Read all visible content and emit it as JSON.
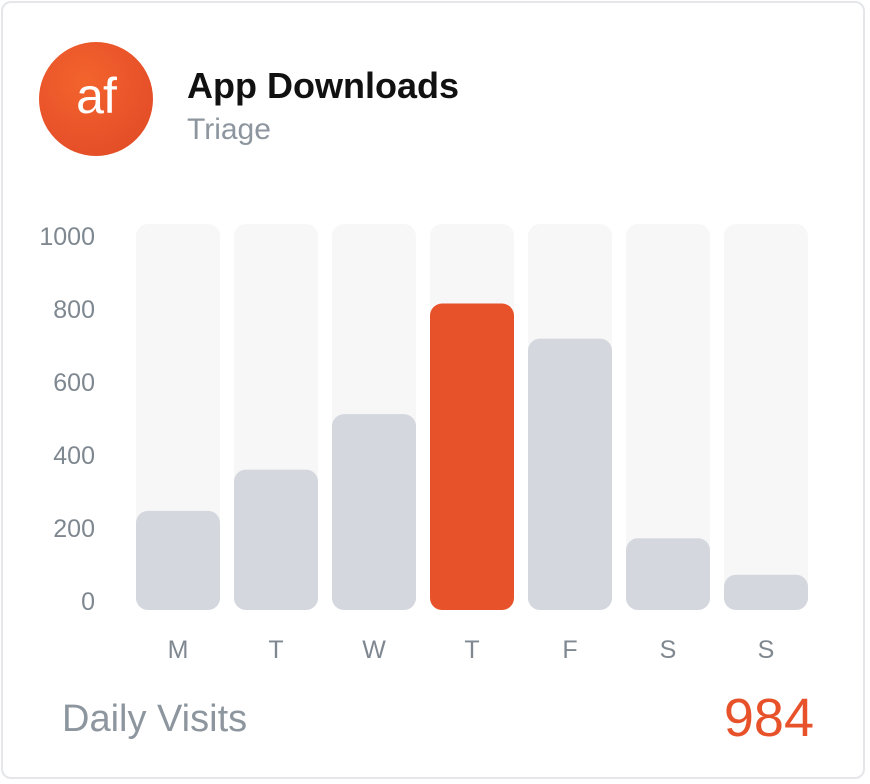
{
  "header": {
    "avatar_text": "af",
    "title": "App Downloads",
    "subtitle": "Triage"
  },
  "colors": {
    "accent": "#e8522a",
    "bar": "#d4d8de",
    "track": "#f7f7f7",
    "axis_text": "#7f8890"
  },
  "chart_data": {
    "type": "bar",
    "title": "",
    "xlabel": "",
    "ylabel": "",
    "categories": [
      "M",
      "T",
      "W",
      "T",
      "F",
      "S",
      "S"
    ],
    "values": [
      225,
      338,
      490,
      793,
      697,
      150,
      50
    ],
    "ylim": [
      0,
      1000
    ],
    "yticks": [
      "0",
      "200",
      "400",
      "600",
      "800",
      "1000"
    ],
    "highlight_index": 3,
    "grid": false,
    "legend": "none"
  },
  "footer": {
    "label": "Daily Visits",
    "value": "984"
  }
}
